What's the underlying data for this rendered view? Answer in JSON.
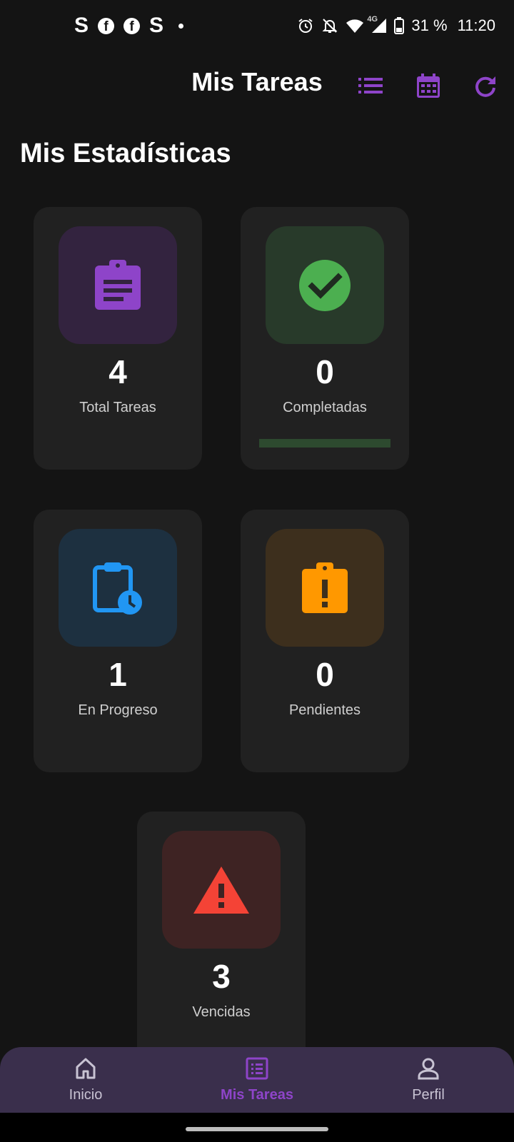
{
  "status_bar": {
    "left_glyphs": [
      "S",
      "f",
      "f",
      "S"
    ],
    "battery_text": "31 %",
    "time": "11:20",
    "network_label": "4G"
  },
  "app_bar": {
    "title": "Mis Tareas",
    "actions": [
      "list-icon",
      "calendar-icon",
      "refresh-icon"
    ],
    "accent_color": "#8e44c9"
  },
  "section": {
    "title": "Mis Estadísticas"
  },
  "stats": [
    {
      "value": "4",
      "label": "Total Tareas",
      "icon": "assignment-icon",
      "color": "#8e44c9",
      "bg": "#33233f"
    },
    {
      "value": "0",
      "label": "Completadas",
      "icon": "check-circle-icon",
      "color": "#4caf50",
      "bg": "#283a2a",
      "progress": 0
    },
    {
      "value": "1",
      "label": "En Progreso",
      "icon": "clipboard-clock-icon",
      "color": "#2196f3",
      "bg": "#1d3040"
    },
    {
      "value": "0",
      "label": "Pendientes",
      "icon": "clipboard-alert-icon",
      "color": "#ff9800",
      "bg": "#3d2f1d"
    },
    {
      "value": "3",
      "label": "Vencidas",
      "icon": "warning-icon",
      "color": "#f44336",
      "bg": "#3e2323"
    }
  ],
  "bottom_nav": {
    "items": [
      {
        "label": "Inicio",
        "icon": "home-icon",
        "active": false
      },
      {
        "label": "Mis Tareas",
        "icon": "tasks-list-icon",
        "active": true
      },
      {
        "label": "Perfil",
        "icon": "person-icon",
        "active": false
      }
    ],
    "active_color": "#8e44c9",
    "inactive_color": "#c8c3d3"
  }
}
